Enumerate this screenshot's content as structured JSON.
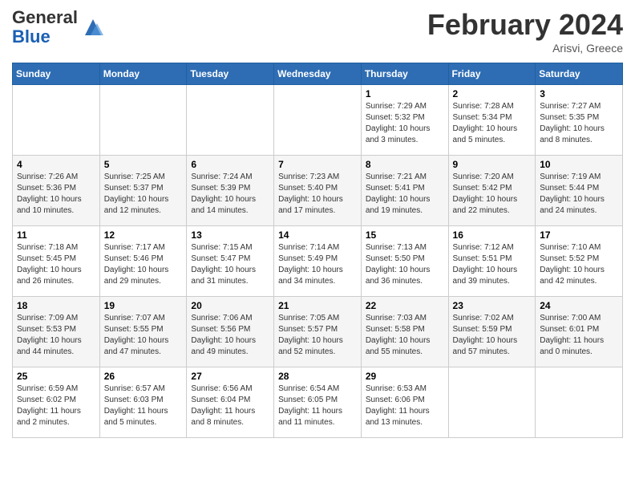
{
  "header": {
    "logo_general": "General",
    "logo_blue": "Blue",
    "title": "February 2024",
    "location": "Arisvi, Greece"
  },
  "calendar": {
    "weekdays": [
      "Sunday",
      "Monday",
      "Tuesday",
      "Wednesday",
      "Thursday",
      "Friday",
      "Saturday"
    ],
    "weeks": [
      [
        {
          "day": "",
          "info": ""
        },
        {
          "day": "",
          "info": ""
        },
        {
          "day": "",
          "info": ""
        },
        {
          "day": "",
          "info": ""
        },
        {
          "day": "1",
          "info": "Sunrise: 7:29 AM\nSunset: 5:32 PM\nDaylight: 10 hours\nand 3 minutes."
        },
        {
          "day": "2",
          "info": "Sunrise: 7:28 AM\nSunset: 5:34 PM\nDaylight: 10 hours\nand 5 minutes."
        },
        {
          "day": "3",
          "info": "Sunrise: 7:27 AM\nSunset: 5:35 PM\nDaylight: 10 hours\nand 8 minutes."
        }
      ],
      [
        {
          "day": "4",
          "info": "Sunrise: 7:26 AM\nSunset: 5:36 PM\nDaylight: 10 hours\nand 10 minutes."
        },
        {
          "day": "5",
          "info": "Sunrise: 7:25 AM\nSunset: 5:37 PM\nDaylight: 10 hours\nand 12 minutes."
        },
        {
          "day": "6",
          "info": "Sunrise: 7:24 AM\nSunset: 5:39 PM\nDaylight: 10 hours\nand 14 minutes."
        },
        {
          "day": "7",
          "info": "Sunrise: 7:23 AM\nSunset: 5:40 PM\nDaylight: 10 hours\nand 17 minutes."
        },
        {
          "day": "8",
          "info": "Sunrise: 7:21 AM\nSunset: 5:41 PM\nDaylight: 10 hours\nand 19 minutes."
        },
        {
          "day": "9",
          "info": "Sunrise: 7:20 AM\nSunset: 5:42 PM\nDaylight: 10 hours\nand 22 minutes."
        },
        {
          "day": "10",
          "info": "Sunrise: 7:19 AM\nSunset: 5:44 PM\nDaylight: 10 hours\nand 24 minutes."
        }
      ],
      [
        {
          "day": "11",
          "info": "Sunrise: 7:18 AM\nSunset: 5:45 PM\nDaylight: 10 hours\nand 26 minutes."
        },
        {
          "day": "12",
          "info": "Sunrise: 7:17 AM\nSunset: 5:46 PM\nDaylight: 10 hours\nand 29 minutes."
        },
        {
          "day": "13",
          "info": "Sunrise: 7:15 AM\nSunset: 5:47 PM\nDaylight: 10 hours\nand 31 minutes."
        },
        {
          "day": "14",
          "info": "Sunrise: 7:14 AM\nSunset: 5:49 PM\nDaylight: 10 hours\nand 34 minutes."
        },
        {
          "day": "15",
          "info": "Sunrise: 7:13 AM\nSunset: 5:50 PM\nDaylight: 10 hours\nand 36 minutes."
        },
        {
          "day": "16",
          "info": "Sunrise: 7:12 AM\nSunset: 5:51 PM\nDaylight: 10 hours\nand 39 minutes."
        },
        {
          "day": "17",
          "info": "Sunrise: 7:10 AM\nSunset: 5:52 PM\nDaylight: 10 hours\nand 42 minutes."
        }
      ],
      [
        {
          "day": "18",
          "info": "Sunrise: 7:09 AM\nSunset: 5:53 PM\nDaylight: 10 hours\nand 44 minutes."
        },
        {
          "day": "19",
          "info": "Sunrise: 7:07 AM\nSunset: 5:55 PM\nDaylight: 10 hours\nand 47 minutes."
        },
        {
          "day": "20",
          "info": "Sunrise: 7:06 AM\nSunset: 5:56 PM\nDaylight: 10 hours\nand 49 minutes."
        },
        {
          "day": "21",
          "info": "Sunrise: 7:05 AM\nSunset: 5:57 PM\nDaylight: 10 hours\nand 52 minutes."
        },
        {
          "day": "22",
          "info": "Sunrise: 7:03 AM\nSunset: 5:58 PM\nDaylight: 10 hours\nand 55 minutes."
        },
        {
          "day": "23",
          "info": "Sunrise: 7:02 AM\nSunset: 5:59 PM\nDaylight: 10 hours\nand 57 minutes."
        },
        {
          "day": "24",
          "info": "Sunrise: 7:00 AM\nSunset: 6:01 PM\nDaylight: 11 hours\nand 0 minutes."
        }
      ],
      [
        {
          "day": "25",
          "info": "Sunrise: 6:59 AM\nSunset: 6:02 PM\nDaylight: 11 hours\nand 2 minutes."
        },
        {
          "day": "26",
          "info": "Sunrise: 6:57 AM\nSunset: 6:03 PM\nDaylight: 11 hours\nand 5 minutes."
        },
        {
          "day": "27",
          "info": "Sunrise: 6:56 AM\nSunset: 6:04 PM\nDaylight: 11 hours\nand 8 minutes."
        },
        {
          "day": "28",
          "info": "Sunrise: 6:54 AM\nSunset: 6:05 PM\nDaylight: 11 hours\nand 11 minutes."
        },
        {
          "day": "29",
          "info": "Sunrise: 6:53 AM\nSunset: 6:06 PM\nDaylight: 11 hours\nand 13 minutes."
        },
        {
          "day": "",
          "info": ""
        },
        {
          "day": "",
          "info": ""
        }
      ]
    ]
  }
}
